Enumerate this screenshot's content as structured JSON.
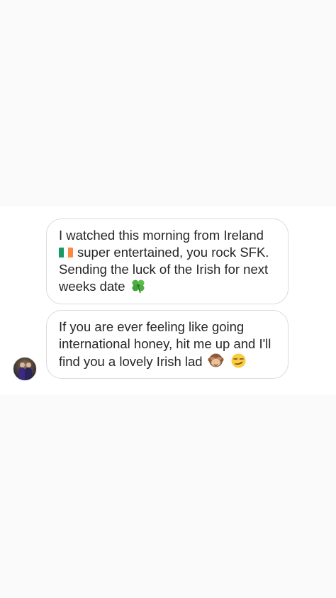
{
  "conversation": {
    "messages": [
      {
        "lines": [
          "I watched this morning from Ireland",
          "super entertained, you rock SFK.",
          "Sending the luck of the Irish for next",
          "weeks date"
        ],
        "icons": [
          "ireland-flag-icon",
          "shamrock-icon"
        ]
      },
      {
        "lines": [
          "If you are ever feeling like going",
          "international honey, hit me up and I'll",
          "find you a lovely Irish lad"
        ],
        "icons": [
          "see-no-evil-monkey-icon",
          "smirking-face-icon"
        ]
      }
    ],
    "colors": {
      "bubble_border": "#dbdbdb",
      "text": "#262626",
      "background": "#fafafa",
      "chat_background": "#ffffff",
      "flag_green": "#169b62",
      "flag_white": "#ffffff",
      "flag_orange": "#ff883e"
    }
  }
}
